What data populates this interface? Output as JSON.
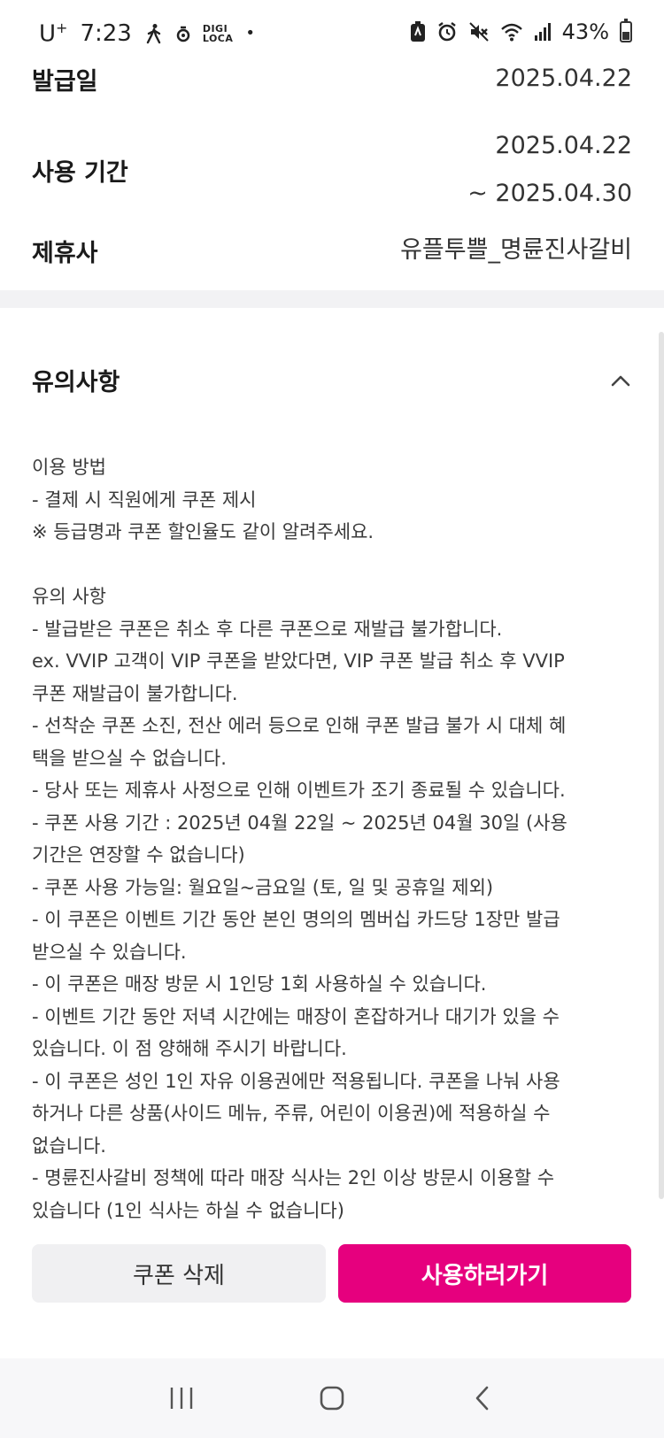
{
  "status_bar": {
    "carrier": "U",
    "carrier_sup": "+",
    "time": "7:23",
    "digi_top": "DIGI",
    "digi_bottom": "LOCA",
    "dot": "•",
    "battery": "43%"
  },
  "info": {
    "issue_date_label": "발급일",
    "issue_date_value": "2025.04.22",
    "period_label": "사용 기간",
    "period_start": "2025.04.22",
    "period_end": "~ 2025.04.30",
    "partner_label": "제휴사",
    "partner_value": "유플투쁠_명륜진사갈비"
  },
  "notice": {
    "title": "유의사항",
    "lines": [
      "이용 방법",
      "- 결제 시 직원에게 쿠폰 제시",
      "※ 등급명과 쿠폰 할인율도 같이 알려주세요.",
      "",
      "유의 사항",
      "- 발급받은 쿠폰은 취소 후 다른 쿠폰으로 재발급 불가합니다.",
      "ex. VVIP 고객이 VIP 쿠폰을 받았다면, VIP 쿠폰 발급 취소 후 VVIP",
      "쿠폰 재발급이 불가합니다.",
      "- 선착순 쿠폰 소진, 전산 에러 등으로 인해 쿠폰 발급 불가 시 대체 혜",
      "택을 받으실 수 없습니다.",
      "- 당사 또는 제휴사 사정으로 인해 이벤트가 조기 종료될 수 있습니다.",
      "- 쿠폰 사용 기간 : 2025년 04월 22일 ~ 2025년 04월 30일 (사용",
      "기간은 연장할 수 없습니다)",
      "- 쿠폰 사용 가능일: 월요일~금요일 (토, 일 및 공휴일 제외)",
      "- 이 쿠폰은 이벤트 기간 동안 본인 명의의 멤버십 카드당 1장만 발급",
      "받으실 수 있습니다.",
      "- 이 쿠폰은 매장 방문 시 1인당 1회 사용하실 수 있습니다.",
      "- 이벤트 기간 동안 저녁 시간에는 매장이 혼잡하거나 대기가 있을 수",
      "있습니다. 이 점 양해해 주시기 바랍니다.",
      "- 이 쿠폰은 성인 1인 자유 이용권에만 적용됩니다. 쿠폰을 나눠 사용",
      "하거나 다른 상품(사이드 메뉴, 주류, 어린이 이용권)에 적용하실 수",
      "없습니다.",
      "- 명륜진사갈비 정책에 따라 매장 식사는 2인 이상 방문시 이용할 수",
      "있습니다 (1인 식사는 하실 수 없습니다)"
    ]
  },
  "actions": {
    "delete_label": "쿠폰 삭제",
    "use_label": "사용하러가기"
  },
  "colors": {
    "accent": "#e6007e",
    "secondary_button": "#f0f0f2"
  }
}
